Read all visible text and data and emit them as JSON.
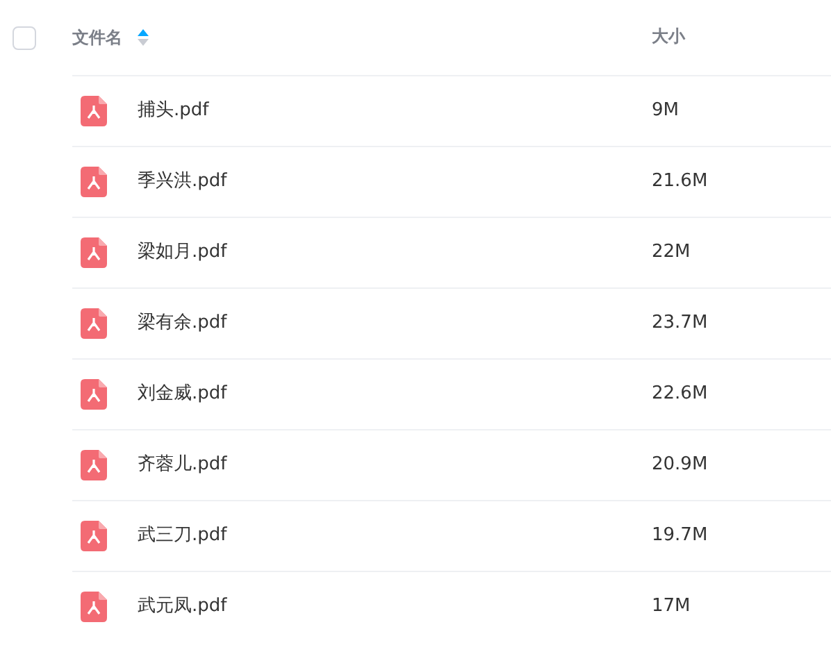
{
  "header": {
    "select_all": {
      "checked": false
    },
    "columns": [
      {
        "label": "文件名",
        "sorted_ascending": true
      },
      {
        "label": "大小"
      }
    ]
  },
  "rows": [
    {
      "name": "捕头.pdf",
      "size": "9M"
    },
    {
      "name": "季兴洪.pdf",
      "size": "21.6M"
    },
    {
      "name": "梁如月.pdf",
      "size": "22M"
    },
    {
      "name": "梁有余.pdf",
      "size": "23.7M"
    },
    {
      "name": "刘金威.pdf",
      "size": "22.6M"
    },
    {
      "name": "齐蓉儿.pdf",
      "size": "20.9M"
    },
    {
      "name": "武三刀.pdf",
      "size": "19.7M"
    },
    {
      "name": "武元凤.pdf",
      "size": "17M"
    }
  ]
}
